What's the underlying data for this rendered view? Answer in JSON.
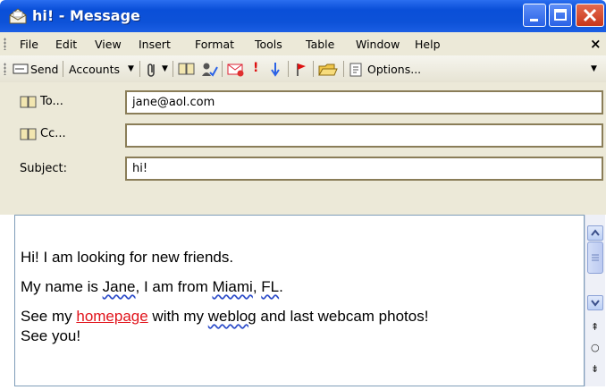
{
  "window": {
    "title": "hi! - Message",
    "icon": "message-icon",
    "controls": [
      "minimize",
      "maximize",
      "close"
    ]
  },
  "menu": {
    "items": [
      {
        "label": "File"
      },
      {
        "label": "Edit"
      },
      {
        "label": "View"
      },
      {
        "label": "Insert"
      },
      {
        "label": "Format"
      },
      {
        "label": "Tools"
      },
      {
        "label": "Table"
      },
      {
        "label": "Window"
      },
      {
        "label": "Help"
      }
    ],
    "close_glyph": "×"
  },
  "toolbar": {
    "send_label": "Send",
    "accounts_label": "Accounts",
    "options_label": "Options..."
  },
  "header": {
    "to_label": "To...",
    "to_value": "jane@aol.com",
    "cc_label": "Cc...",
    "cc_value": "",
    "subject_label": "Subject:",
    "subject_value": "hi!"
  },
  "body": {
    "line1": "Hi! I am looking for new friends.",
    "line2_a": "My name is ",
    "line2_jane": "Jane",
    "line2_b": ", I am from ",
    "line2_miami": "Miami",
    "line2_c": ", ",
    "line2_fl": "FL",
    "line2_d": ".",
    "line3_a": "See my ",
    "line3_link": "homepage",
    "line3_b": " with my ",
    "line3_weblog": "weblog",
    "line3_c": " and last webcam photos!",
    "line4": "See you!"
  },
  "colors": {
    "titlebar": "#0a4fd8",
    "link": "#e1141c",
    "close_button": "#c8371b"
  }
}
